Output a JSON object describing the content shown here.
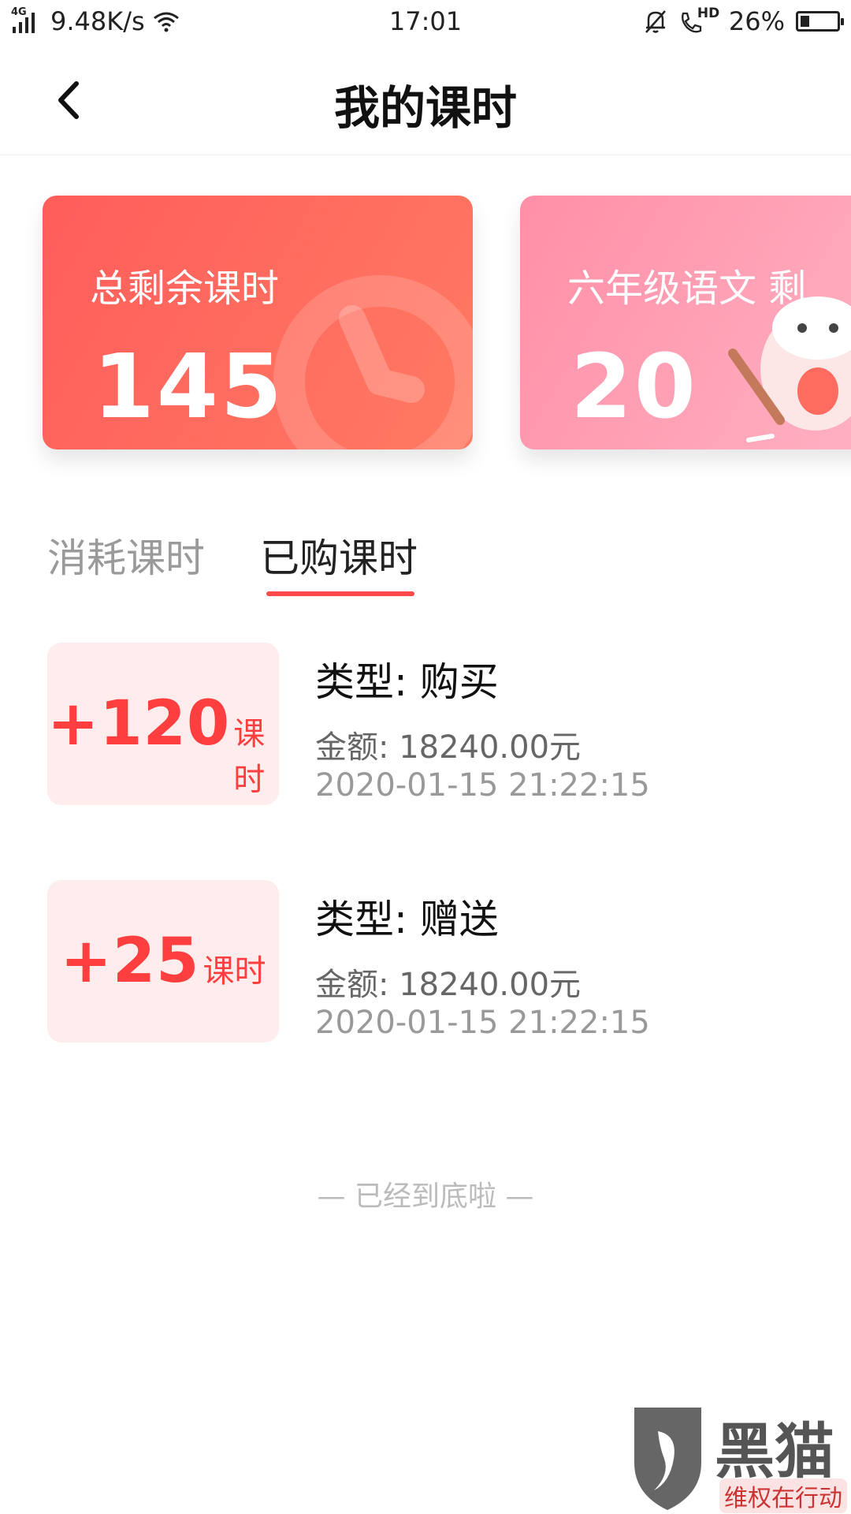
{
  "status_bar": {
    "network": "4G",
    "speed": "9.48K/s",
    "time": "17:01",
    "hd": "HD",
    "battery": "26%",
    "battery_level": 0.26
  },
  "header": {
    "title": "我的课时"
  },
  "cards": [
    {
      "label": "总剩余课时",
      "value": "145"
    },
    {
      "label": "六年级语文  剩",
      "value": "20"
    }
  ],
  "tabs": [
    {
      "label": "消耗课时",
      "active": false
    },
    {
      "label": "已购课时",
      "active": true
    }
  ],
  "records": [
    {
      "delta": "+120",
      "unit": "课时",
      "type": "类型: 购买",
      "amount": "金额: 18240.00元",
      "time": "2020-01-15 21:22:15"
    },
    {
      "delta": "+25",
      "unit": "课时",
      "type": "类型: 赠送",
      "amount": "金额: 18240.00元",
      "time": "2020-01-15 21:22:15"
    }
  ],
  "footer": {
    "end_hint": "— 已经到底啦 —"
  },
  "watermark": {
    "text": "黑猫",
    "sub": "维权在行动"
  },
  "colors": {
    "accent": "#ff4a4a",
    "card_total": "#ff6a5e",
    "card_subject": "#ff9db3",
    "badge_bg": "#ffecec"
  }
}
